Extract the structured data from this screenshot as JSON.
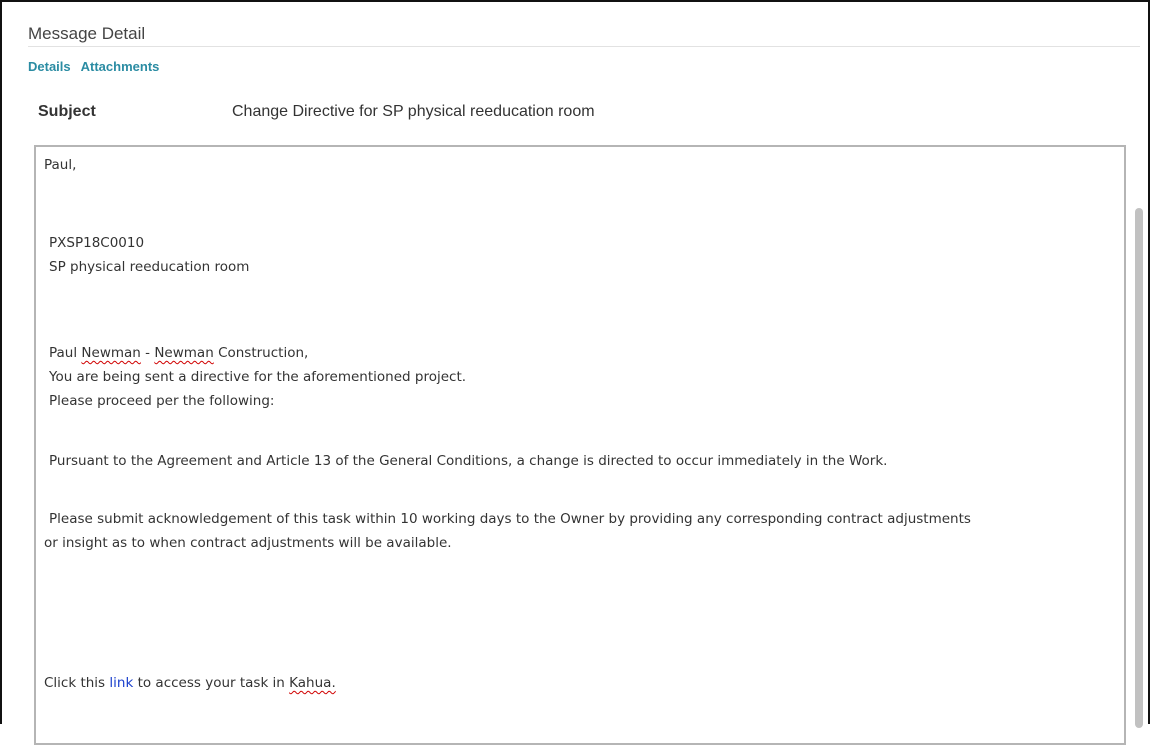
{
  "header": {
    "title": "Message Detail"
  },
  "tabs": [
    {
      "label": "Details"
    },
    {
      "label": "Attachments"
    }
  ],
  "subject": {
    "label": "Subject",
    "value": "Change Directive for SP physical reeducation room"
  },
  "message": {
    "greeting": "Paul,",
    "project_code": "PXSP18C0010",
    "project_name": "SP physical reeducation room",
    "recipient_first": "Paul",
    "recipient_last": "Newman",
    "recipient_dash": "-",
    "company_first": "Newman",
    "company_rest": "Construction,",
    "line_directive": "You are being sent a directive for the aforementioned project.",
    "line_proceed": "Please proceed per the following:",
    "line_pursuant": "Pursuant to the Agreement and Article 13 of the General Conditions, a change is directed to occur immediately in the Work.",
    "line_submit_1": "Please submit acknowledgement of this task within 10 working days to the Owner by providing any corresponding contract adjustments",
    "line_submit_2": "or insight as to when contract adjustments will be available.",
    "click_prefix": "Click this",
    "click_link": "link",
    "click_suffix": "to access your task in",
    "app_name": "Kahua."
  }
}
